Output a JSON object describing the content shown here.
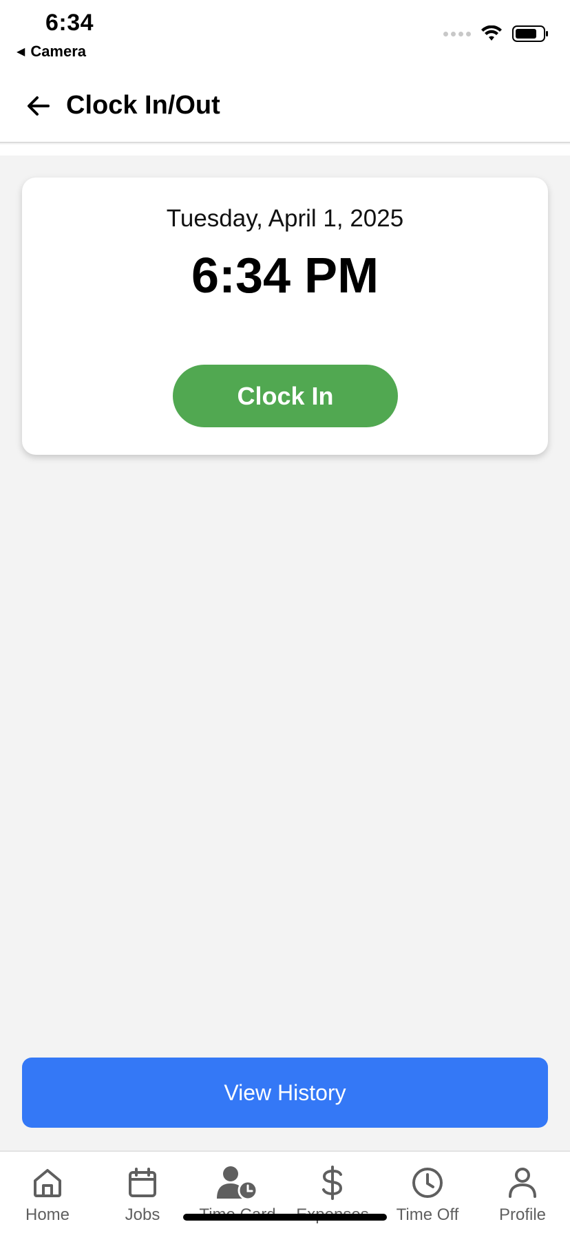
{
  "status_bar": {
    "time": "6:34",
    "back_app": "Camera",
    "icons": [
      "signal-icon",
      "wifi-icon",
      "battery-icon"
    ]
  },
  "header": {
    "title": "Clock In/Out",
    "back_icon": "arrow-left-icon"
  },
  "clock_card": {
    "date": "Tuesday, April 1, 2025",
    "time": "6:34 PM",
    "clock_in_label": "Clock In"
  },
  "view_history_label": "View History",
  "tabs": [
    {
      "label": "Home",
      "icon": "home-icon"
    },
    {
      "label": "Jobs",
      "icon": "calendar-icon"
    },
    {
      "label": "Time Card",
      "icon": "user-clock-icon"
    },
    {
      "label": "Expenses",
      "icon": "dollar-icon"
    },
    {
      "label": "Time Off",
      "icon": "clock-icon"
    },
    {
      "label": "Profile",
      "icon": "person-icon"
    }
  ],
  "colors": {
    "accent_green": "#51a851",
    "accent_blue": "#3478f6",
    "background": "#f3f3f3"
  }
}
